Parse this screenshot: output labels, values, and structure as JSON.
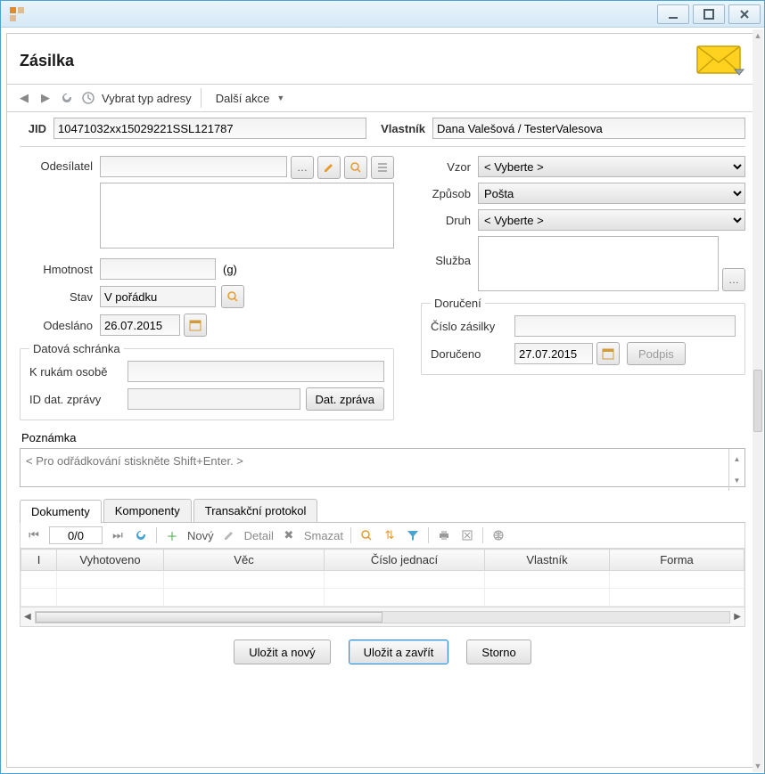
{
  "window": {
    "title": "Zásilka"
  },
  "toolbar": {
    "select_address_type": "Vybrat typ adresy",
    "more_actions": "Další akce"
  },
  "top": {
    "jid_label": "JID",
    "jid_value": "10471032xx15029221SSL121787",
    "owner_label": "Vlastník",
    "owner_value": "Dana Valešová / TesterValesova"
  },
  "left": {
    "sender_label": "Odesílatel",
    "sender_value": "",
    "weight_label": "Hmotnost",
    "weight_value": "",
    "weight_unit": "(g)",
    "state_label": "Stav",
    "state_value": "V pořádku",
    "sent_label": "Odesláno",
    "sent_value": "26.07.2015",
    "databox_legend": "Datová schránka",
    "to_hands_label": "K rukám osobě",
    "to_hands_value": "",
    "msg_id_label": "ID dat. zprávy",
    "msg_id_value": "",
    "msg_btn": "Dat. zpráva"
  },
  "right": {
    "template_label": "Vzor",
    "template_value": "< Vyberte >",
    "method_label": "Způsob",
    "method_value": "Pošta",
    "kind_label": "Druh",
    "kind_value": "< Vyberte >",
    "service_label": "Služba",
    "service_value": "",
    "delivery_legend": "Doručení",
    "shipment_no_label": "Číslo zásilky",
    "shipment_no_value": "",
    "delivered_label": "Doručeno",
    "delivered_value": "27.07.2015",
    "signature_btn": "Podpis"
  },
  "note": {
    "label": "Poznámka",
    "placeholder": "< Pro odřádkování stiskněte Shift+Enter. >"
  },
  "tabs": {
    "documents": "Dokumenty",
    "components": "Komponenty",
    "tx_log": "Transakční protokol"
  },
  "grid": {
    "pager": "0/0",
    "new_btn": "Nový",
    "detail_btn": "Detail",
    "delete_btn": "Smazat",
    "columns": [
      "I",
      "Vyhotoveno",
      "Věc",
      "Číslo jednací",
      "Vlastník",
      "Forma"
    ]
  },
  "footer": {
    "save_new": "Uložit a nový",
    "save_close": "Uložit a zavřít",
    "cancel": "Storno"
  }
}
